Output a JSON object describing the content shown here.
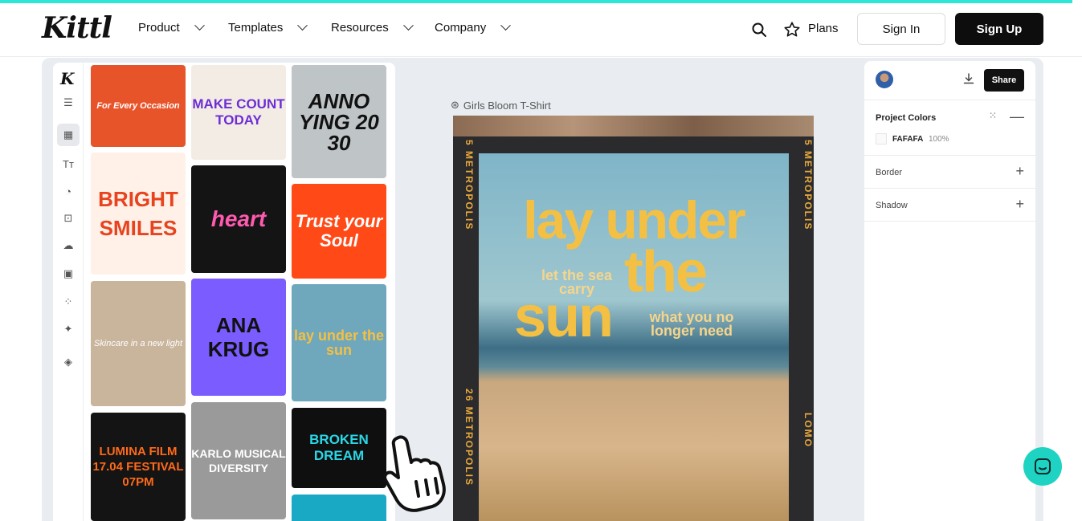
{
  "nav": {
    "logo": "Kittl",
    "items": [
      {
        "label": "Product"
      },
      {
        "label": "Templates"
      },
      {
        "label": "Resources"
      },
      {
        "label": "Company"
      }
    ],
    "plans_label": "Plans",
    "signin_label": "Sign In",
    "signup_label": "Sign Up"
  },
  "editor": {
    "rail_logo": "K",
    "rail_icons": [
      "menu-icon",
      "templates-icon",
      "text-icon",
      "shapes-icon",
      "elements-icon",
      "upload-icon",
      "image-icon",
      "grid-icon",
      "ai-sparkle-icon",
      "layers-icon"
    ],
    "canvas_label": "Girls Bloom T-Shirt",
    "templates": [
      {
        "text": "For Every Occasion",
        "bg": "#e8542a"
      },
      {
        "text": "MAKE COUNT TODAY",
        "bg": "#f2ece4"
      },
      {
        "text": "ANNO YING 20 30",
        "bg": "#bfc4c7"
      },
      {
        "text": "BRIGHT SMILES",
        "bg": "#fff1e8"
      },
      {
        "text": "heart",
        "bg": "#141414"
      },
      {
        "text": "Trust your Soul",
        "bg": "#ff4a18"
      },
      {
        "text": "Skincare in a new light",
        "bg": "#c9b49c"
      },
      {
        "text": "ANA KRUG",
        "bg": "#7b5cff"
      },
      {
        "text": "lay under the sun",
        "bg": "#6fa7bd"
      },
      {
        "text": "LUMINA FILM 17.04 FESTIVAL 07PM",
        "bg": "#141414"
      },
      {
        "text": "KARLO MUSICAL DIVERSITY",
        "bg": "#9a9a9a"
      },
      {
        "text": "BROKEN DREAM",
        "bg": "#0f0f0f"
      }
    ],
    "poster": {
      "side_left": "5 METROPOLIS",
      "side_right": "5 METROPOLIS",
      "side_left_bottom": "26 METROPOLIS",
      "side_right_bottom": "LOMO",
      "line1": "lay under",
      "line2": "the",
      "line3": "sun",
      "sub1": "let the sea carry",
      "sub2": "what you no longer need"
    },
    "props": {
      "share_label": "Share",
      "project_colors_label": "Project Colors",
      "color_hex": "FAFAFA",
      "color_pct": "100%",
      "border_label": "Border",
      "shadow_label": "Shadow"
    }
  },
  "colors": {
    "accent": "#2ee6d6",
    "chat": "#1fd3c3",
    "poster_yellow": "#f4c043"
  }
}
